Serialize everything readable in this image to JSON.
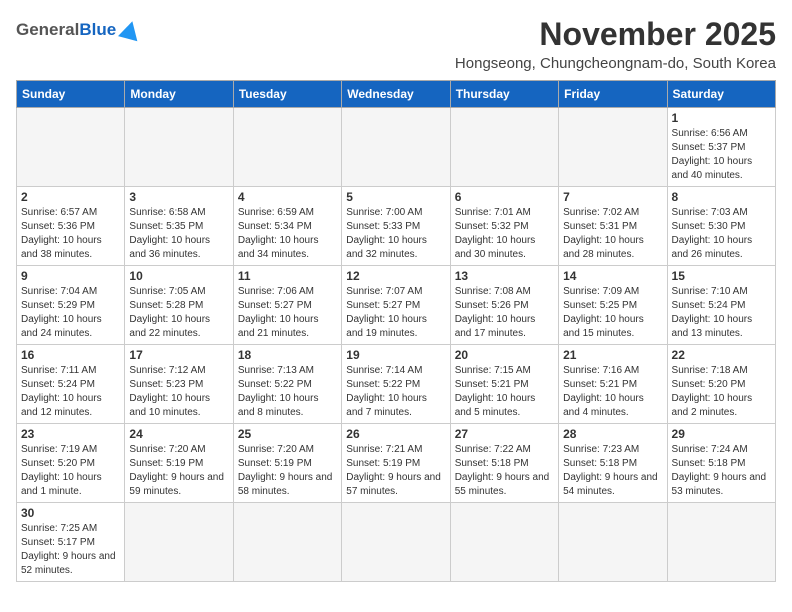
{
  "logo": {
    "general": "General",
    "blue": "Blue"
  },
  "title": "November 2025",
  "location": "Hongseong, Chungcheongnam-do, South Korea",
  "days_of_week": [
    "Sunday",
    "Monday",
    "Tuesday",
    "Wednesday",
    "Thursday",
    "Friday",
    "Saturday"
  ],
  "weeks": [
    [
      {
        "day": "",
        "info": ""
      },
      {
        "day": "",
        "info": ""
      },
      {
        "day": "",
        "info": ""
      },
      {
        "day": "",
        "info": ""
      },
      {
        "day": "",
        "info": ""
      },
      {
        "day": "",
        "info": ""
      },
      {
        "day": "1",
        "info": "Sunrise: 6:56 AM\nSunset: 5:37 PM\nDaylight: 10 hours and 40 minutes."
      }
    ],
    [
      {
        "day": "2",
        "info": "Sunrise: 6:57 AM\nSunset: 5:36 PM\nDaylight: 10 hours and 38 minutes."
      },
      {
        "day": "3",
        "info": "Sunrise: 6:58 AM\nSunset: 5:35 PM\nDaylight: 10 hours and 36 minutes."
      },
      {
        "day": "4",
        "info": "Sunrise: 6:59 AM\nSunset: 5:34 PM\nDaylight: 10 hours and 34 minutes."
      },
      {
        "day": "5",
        "info": "Sunrise: 7:00 AM\nSunset: 5:33 PM\nDaylight: 10 hours and 32 minutes."
      },
      {
        "day": "6",
        "info": "Sunrise: 7:01 AM\nSunset: 5:32 PM\nDaylight: 10 hours and 30 minutes."
      },
      {
        "day": "7",
        "info": "Sunrise: 7:02 AM\nSunset: 5:31 PM\nDaylight: 10 hours and 28 minutes."
      },
      {
        "day": "8",
        "info": "Sunrise: 7:03 AM\nSunset: 5:30 PM\nDaylight: 10 hours and 26 minutes."
      }
    ],
    [
      {
        "day": "9",
        "info": "Sunrise: 7:04 AM\nSunset: 5:29 PM\nDaylight: 10 hours and 24 minutes."
      },
      {
        "day": "10",
        "info": "Sunrise: 7:05 AM\nSunset: 5:28 PM\nDaylight: 10 hours and 22 minutes."
      },
      {
        "day": "11",
        "info": "Sunrise: 7:06 AM\nSunset: 5:27 PM\nDaylight: 10 hours and 21 minutes."
      },
      {
        "day": "12",
        "info": "Sunrise: 7:07 AM\nSunset: 5:27 PM\nDaylight: 10 hours and 19 minutes."
      },
      {
        "day": "13",
        "info": "Sunrise: 7:08 AM\nSunset: 5:26 PM\nDaylight: 10 hours and 17 minutes."
      },
      {
        "day": "14",
        "info": "Sunrise: 7:09 AM\nSunset: 5:25 PM\nDaylight: 10 hours and 15 minutes."
      },
      {
        "day": "15",
        "info": "Sunrise: 7:10 AM\nSunset: 5:24 PM\nDaylight: 10 hours and 13 minutes."
      }
    ],
    [
      {
        "day": "16",
        "info": "Sunrise: 7:11 AM\nSunset: 5:24 PM\nDaylight: 10 hours and 12 minutes."
      },
      {
        "day": "17",
        "info": "Sunrise: 7:12 AM\nSunset: 5:23 PM\nDaylight: 10 hours and 10 minutes."
      },
      {
        "day": "18",
        "info": "Sunrise: 7:13 AM\nSunset: 5:22 PM\nDaylight: 10 hours and 8 minutes."
      },
      {
        "day": "19",
        "info": "Sunrise: 7:14 AM\nSunset: 5:22 PM\nDaylight: 10 hours and 7 minutes."
      },
      {
        "day": "20",
        "info": "Sunrise: 7:15 AM\nSunset: 5:21 PM\nDaylight: 10 hours and 5 minutes."
      },
      {
        "day": "21",
        "info": "Sunrise: 7:16 AM\nSunset: 5:21 PM\nDaylight: 10 hours and 4 minutes."
      },
      {
        "day": "22",
        "info": "Sunrise: 7:18 AM\nSunset: 5:20 PM\nDaylight: 10 hours and 2 minutes."
      }
    ],
    [
      {
        "day": "23",
        "info": "Sunrise: 7:19 AM\nSunset: 5:20 PM\nDaylight: 10 hours and 1 minute."
      },
      {
        "day": "24",
        "info": "Sunrise: 7:20 AM\nSunset: 5:19 PM\nDaylight: 9 hours and 59 minutes."
      },
      {
        "day": "25",
        "info": "Sunrise: 7:20 AM\nSunset: 5:19 PM\nDaylight: 9 hours and 58 minutes."
      },
      {
        "day": "26",
        "info": "Sunrise: 7:21 AM\nSunset: 5:19 PM\nDaylight: 9 hours and 57 minutes."
      },
      {
        "day": "27",
        "info": "Sunrise: 7:22 AM\nSunset: 5:18 PM\nDaylight: 9 hours and 55 minutes."
      },
      {
        "day": "28",
        "info": "Sunrise: 7:23 AM\nSunset: 5:18 PM\nDaylight: 9 hours and 54 minutes."
      },
      {
        "day": "29",
        "info": "Sunrise: 7:24 AM\nSunset: 5:18 PM\nDaylight: 9 hours and 53 minutes."
      }
    ],
    [
      {
        "day": "30",
        "info": "Sunrise: 7:25 AM\nSunset: 5:17 PM\nDaylight: 9 hours and 52 minutes."
      },
      {
        "day": "",
        "info": ""
      },
      {
        "day": "",
        "info": ""
      },
      {
        "day": "",
        "info": ""
      },
      {
        "day": "",
        "info": ""
      },
      {
        "day": "",
        "info": ""
      },
      {
        "day": "",
        "info": ""
      }
    ]
  ]
}
